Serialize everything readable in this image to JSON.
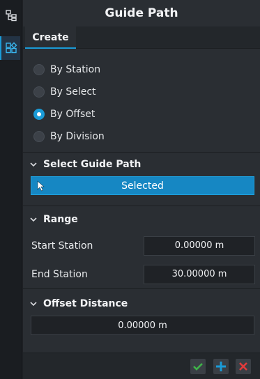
{
  "title": "Guide Path",
  "tabs": [
    {
      "label": "Create"
    }
  ],
  "methods": [
    {
      "label": "By Station",
      "selected": false
    },
    {
      "label": "By Select",
      "selected": false
    },
    {
      "label": "By Offset",
      "selected": true
    },
    {
      "label": "By Division",
      "selected": false
    }
  ],
  "select_guide": {
    "header": "Select Guide Path",
    "button_label": "Selected"
  },
  "range": {
    "header": "Range",
    "start_label": "Start Station",
    "start_value": "0.00000 m",
    "end_label": "End Station",
    "end_value": "30.00000 m"
  },
  "offset": {
    "header": "Offset Distance",
    "value": "0.00000 m"
  },
  "colors": {
    "accent": "#1a9bd7",
    "ok": "#3fb449",
    "add": "#1a9bd7",
    "cancel": "#e23b3b"
  },
  "icons": [
    "tree-icon",
    "components-icon",
    "chevron-down-icon",
    "cursor-icon",
    "check-icon",
    "plus-icon",
    "close-icon"
  ]
}
